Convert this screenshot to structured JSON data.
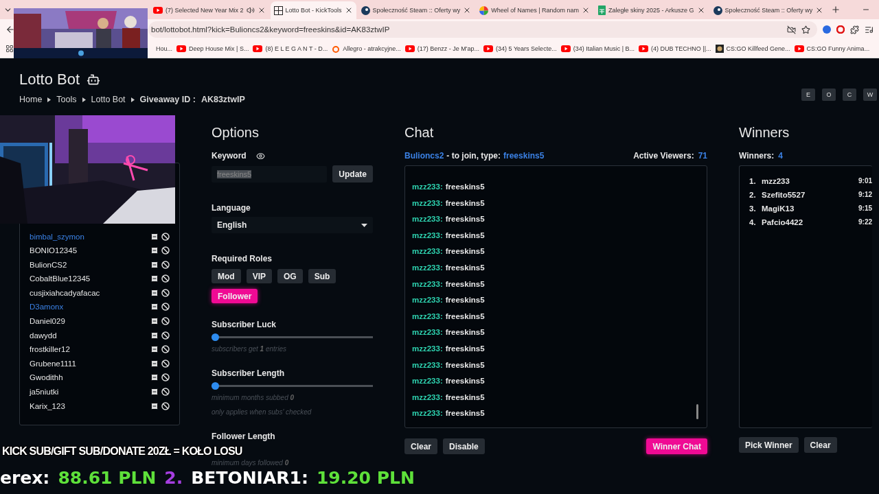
{
  "browser": {
    "tabs": [
      {
        "title": "(7) Selected New Year Mix 2",
        "kind": "youtube",
        "audio": true,
        "selected": false
      },
      {
        "title": "Lotto Bot - KickTools",
        "kind": "grid",
        "audio": false,
        "selected": true
      },
      {
        "title": "Społeczność Steam :: Oferty wy",
        "kind": "steam",
        "audio": false,
        "selected": false
      },
      {
        "title": "Wheel of Names | Random nam",
        "kind": "wheel",
        "audio": false,
        "selected": false
      },
      {
        "title": "Zaległe skiny 2025 - Arkusze G",
        "kind": "sheets",
        "audio": false,
        "selected": false
      },
      {
        "title": "Społeczność Steam :: Oferty wy",
        "kind": "steam",
        "audio": false,
        "selected": false
      }
    ],
    "address": "bot/lottobot.html?kick=Bulioncs2&keyword=freeskins&id=AK83ztwIP",
    "bookmarks": [
      {
        "title": "Hou..."
      },
      {
        "title": "Deep House Mix | S...",
        "kind": "youtube"
      },
      {
        "title": "(8) E L E G A N T - D...",
        "kind": "youtube"
      },
      {
        "title": "Allegro - atrakcyjne...",
        "kind": "allegro"
      },
      {
        "title": "(17) Benzz - Je M'ap...",
        "kind": "youtube"
      },
      {
        "title": "(34) 5 Years Selecte...",
        "kind": "youtube"
      },
      {
        "title": "(34) Italian Music | B...",
        "kind": "youtube"
      },
      {
        "title": "(4) DUB TECHNO ||...",
        "kind": "youtube"
      },
      {
        "title": "CS:GO Killfeed Gene...",
        "kind": "csgo"
      },
      {
        "title": "CS:GO Funny Anima...",
        "kind": "youtube"
      }
    ]
  },
  "page": {
    "title": "Lotto Bot",
    "breadcrumb": [
      "Home",
      "Tools",
      "Lotto Bot"
    ],
    "giveaway_label": "Giveaway ID :",
    "giveaway_id": "AK83ztwIP",
    "view_buttons": [
      "E",
      "O",
      "C",
      "W"
    ]
  },
  "users": [
    {
      "name": "bimbal_szymon",
      "color": "#3b82e6"
    },
    {
      "name": "BONIO12345",
      "color": "#e8e8e8"
    },
    {
      "name": "BulionCS2",
      "color": "#e8e8e8"
    },
    {
      "name": "CobaltBlue12345",
      "color": "#e8e8e8"
    },
    {
      "name": "cusjixiahcadyafacac",
      "color": "#e8e8e8"
    },
    {
      "name": "D3amonx",
      "color": "#3b82e6"
    },
    {
      "name": "Daniel029",
      "color": "#e8e8e8"
    },
    {
      "name": "dawydd",
      "color": "#e8e8e8"
    },
    {
      "name": "frostkiller12",
      "color": "#e8e8e8"
    },
    {
      "name": "Grubene1111",
      "color": "#e8e8e8"
    },
    {
      "name": "Gwodithh",
      "color": "#e8e8e8"
    },
    {
      "name": "ja5niutki",
      "color": "#e8e8e8"
    },
    {
      "name": "Karix_123",
      "color": "#e8e8e8"
    }
  ],
  "options": {
    "title": "Options",
    "keyword_label": "Keyword",
    "keyword_value": "freeskins5",
    "update_button": "Update",
    "language_label": "Language",
    "language": "English",
    "roles_label": "Required Roles",
    "roles": [
      {
        "label": "Mod",
        "selected": false
      },
      {
        "label": "VIP",
        "selected": false
      },
      {
        "label": "OG",
        "selected": false
      },
      {
        "label": "Sub",
        "selected": false
      },
      {
        "label": "Follower",
        "selected": true
      }
    ],
    "sliders": [
      {
        "label": "Subscriber Luck",
        "level": 0,
        "hints": [
          "subscribers get **1** entries"
        ]
      },
      {
        "label": "Subscriber Length",
        "level": 0,
        "hints": [
          "minimum months subbed **0**",
          "only applies when subs' checked"
        ]
      },
      {
        "label": "Follower Length",
        "hints": [
          "minimum days followed **0**"
        ]
      }
    ]
  },
  "chat": {
    "title": "Chat",
    "channel": "Bulioncs2",
    "join_text": "- to join, type:",
    "keyword": "freeskins5",
    "viewers_label": "Active Viewers:",
    "viewers": "71",
    "messages": [
      {
        "user": "mzz233:",
        "text": "freeskins5"
      },
      {
        "user": "mzz233:",
        "text": "freeskins5"
      },
      {
        "user": "mzz233:",
        "text": "freeskins5"
      },
      {
        "user": "mzz233:",
        "text": "freeskins5"
      },
      {
        "user": "mzz233:",
        "text": "freeskins5"
      },
      {
        "user": "mzz233:",
        "text": "freeskins5"
      },
      {
        "user": "mzz233:",
        "text": "freeskins5"
      },
      {
        "user": "mzz233:",
        "text": "freeskins5"
      },
      {
        "user": "mzz233:",
        "text": "freeskins5"
      },
      {
        "user": "mzz233:",
        "text": "freeskins5"
      },
      {
        "user": "mzz233:",
        "text": "freeskins5"
      },
      {
        "user": "mzz233:",
        "text": "freeskins5"
      },
      {
        "user": "mzz233:",
        "text": "freeskins5"
      },
      {
        "user": "mzz233:",
        "text": "freeskins5"
      },
      {
        "user": "mzz233:",
        "text": "freeskins5"
      }
    ],
    "buttons": [
      "Clear",
      "Disable"
    ],
    "winner_button": "Winner Chat"
  },
  "winners": {
    "title": "Winners",
    "count_label": "Winners:",
    "count": "4",
    "list": [
      {
        "rank": "1.",
        "name": "mzz233",
        "time": "9:01"
      },
      {
        "rank": "2.",
        "name": "Szefito5527",
        "time": "9:12"
      },
      {
        "rank": "3.",
        "name": "MagiK13",
        "time": "9:15"
      },
      {
        "rank": "4.",
        "name": "Pafcio4422",
        "time": "9:22"
      }
    ],
    "buttons": [
      "Pick Winner",
      "Clear"
    ]
  },
  "overlays": {
    "promo": "KICK SUB/GIFT SUB/DONATE 20ZŁ = KOŁO LOSU",
    "ticker": [
      {
        "text": "erex:",
        "color": "#ffffff"
      },
      {
        "text": "88.61 PLN",
        "color": "#5ee03a"
      },
      {
        "text": "2.",
        "color": "#a63ee0"
      },
      {
        "text": "BETONIAR1:",
        "color": "#ffffff"
      },
      {
        "text": "19.20 PLN",
        "color": "#5ee03a"
      }
    ]
  }
}
